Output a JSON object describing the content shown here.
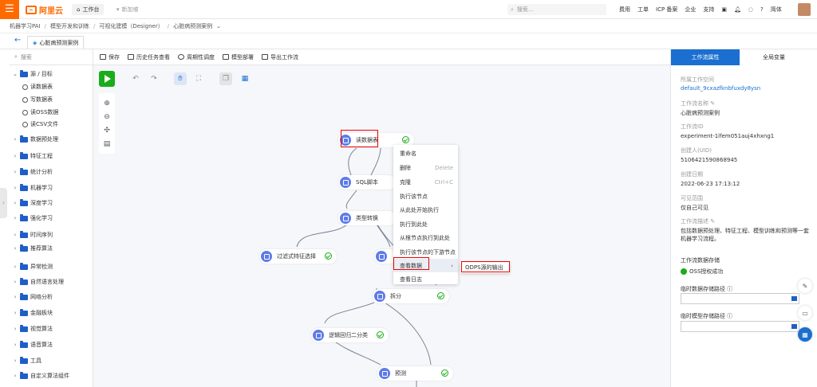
{
  "topbar": {
    "brand": "阿里云",
    "workbench": "工作台",
    "workspace_add": "新加坡",
    "search_placeholder": "搜索...",
    "links": [
      "费用",
      "工单",
      "ICP 备案",
      "企业",
      "支持"
    ],
    "language": "简体"
  },
  "breadcrumb": [
    "机器学习PAI",
    "模型开发和训练",
    "可视化建模（Designer）",
    "心脏病预测案例"
  ],
  "doc_tab": "心脏病预测案例",
  "sidebar": {
    "search_placeholder": "搜索",
    "root": "源 / 目标",
    "leaves": [
      "读数据表",
      "写数据表",
      "读OSS数据",
      "读CSV文件"
    ],
    "folders": [
      "数据预处理",
      "特征工程",
      "统计分析",
      "机器学习",
      "深度学习",
      "强化学习",
      "时间序列",
      "推荐算法",
      "异常检测",
      "自然语言处理",
      "网络分析",
      "金融板块",
      "视觉算法",
      "语音算法",
      "工具",
      "自定义算法组件"
    ]
  },
  "toolbar": {
    "save": "保存",
    "history": "历史任务查看",
    "schedule": "周期性调度",
    "deploy": "模型部署",
    "export": "导出工作流"
  },
  "nodes": {
    "read_table": "读数据表",
    "sql": "SQL脚本",
    "type_convert": "类型转换",
    "filter_feature": "过滤式特征选择",
    "split": "拆分",
    "logistic": "逻辑回归二分类",
    "predict": "预测"
  },
  "context_menu": {
    "rename": "重命名",
    "delete": "删除",
    "delete_shortcut": "Delete",
    "clone": "克隆",
    "clone_shortcut": "Ctrl+C",
    "run_node": "执行该节点",
    "run_from_here": "从此处开始执行",
    "run_to_here": "执行到此处",
    "run_from_root": "从根节点执行到此处",
    "run_downstream": "执行该节点的下游节点",
    "view_data": "查看数据",
    "view_log": "查看日志"
  },
  "submenu": {
    "odps_output": "ODPS源的输出"
  },
  "right_panel": {
    "tab_props": "工作流属性",
    "tab_vars": "全局变量",
    "workspace_label": "所属工作空间",
    "workspace_value": "default_9cxazfknbfuxdy8ysn",
    "name_label": "工作流名称",
    "name_value": "心脏病预测案例",
    "id_label": "工作流ID",
    "id_value": "experiment-1lfem051auj4xhxng1",
    "creator_label": "创建人(UID)",
    "creator_value": "5106421590868945",
    "date_label": "创建日期",
    "date_value": "2022-06-23 17:13:12",
    "visibility_label": "可见范围",
    "visibility_value": "仅自己可见",
    "desc_label": "工作流描述",
    "desc_value_line1": "包括数据预处理、特征工程、模型训练和预测等一套",
    "desc_value_line2": "机器学习流程。",
    "storage_title": "工作流数据存储",
    "oss_status": "OSS授权成功",
    "temp_data_label": "临时数据存储路径",
    "temp_model_label": "临时模型存储路径"
  },
  "colors": {
    "brand": "#ff6a00",
    "accent": "#1a6fd0",
    "run": "#1aad19",
    "node_icon": "#5e7be8",
    "highlight": "#e00000"
  }
}
